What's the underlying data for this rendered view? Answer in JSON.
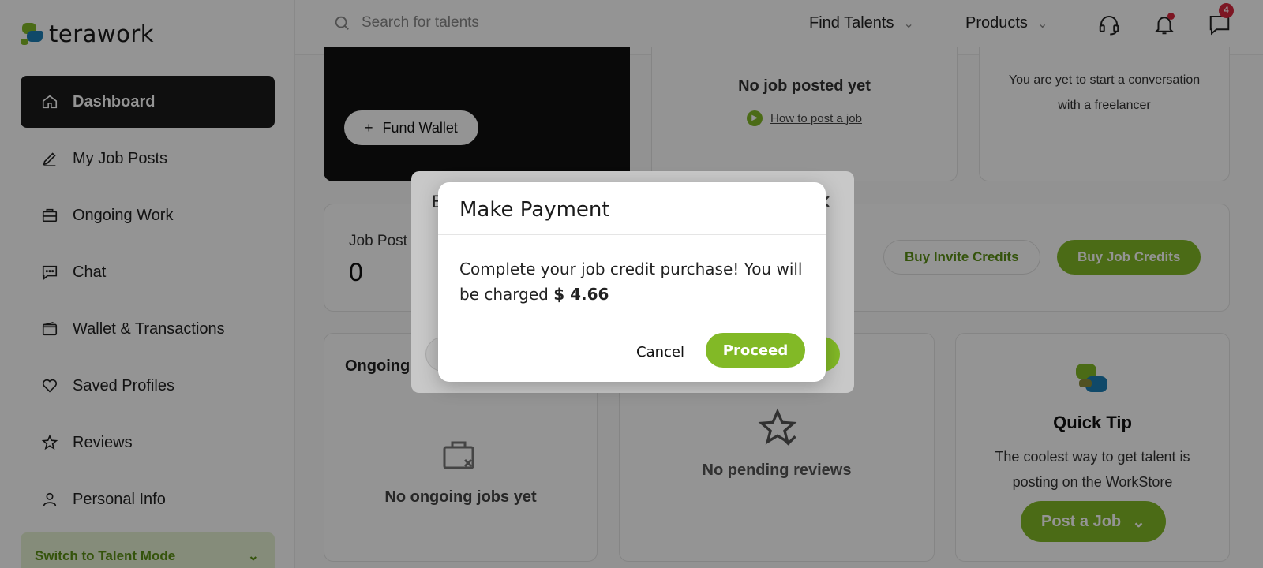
{
  "brand": {
    "name": "terawork"
  },
  "sidebar": {
    "items": [
      {
        "label": "Dashboard",
        "icon": "home-icon",
        "active": true
      },
      {
        "label": "My Job Posts",
        "icon": "pencil-icon"
      },
      {
        "label": "Ongoing Work",
        "icon": "briefcase-icon"
      },
      {
        "label": "Chat",
        "icon": "chat-icon"
      },
      {
        "label": "Wallet & Transactions",
        "icon": "wallet-icon"
      },
      {
        "label": "Saved Profiles",
        "icon": "heart-icon"
      },
      {
        "label": "Reviews",
        "icon": "star-icon"
      },
      {
        "label": "Personal Info",
        "icon": "user-icon"
      }
    ],
    "switch_mode": "Switch to Talent Mode"
  },
  "header": {
    "search_placeholder": "Search for talents",
    "menu": [
      "Find Talents",
      "Products"
    ],
    "messages_badge": "4"
  },
  "wallet": {
    "fund_label": "Fund Wallet"
  },
  "jobs_card": {
    "empty": "No job posted yet",
    "link": "How to post a job"
  },
  "conversation_card": {
    "empty": "You are yet to start a conversation with a freelancer"
  },
  "credits": {
    "job_posts_label": "Job Post",
    "job_posts_value": "0",
    "buy_invite": "Buy Invite Credits",
    "buy_job": "Buy Job Credits"
  },
  "ongoing": {
    "title": "Ongoing",
    "empty": "No ongoing jobs yet"
  },
  "reviews": {
    "empty": "No pending reviews"
  },
  "tip": {
    "title": "Quick Tip",
    "text": "The coolest way to get talent is posting on the WorkStore",
    "button": "Post a Job"
  },
  "back_modal": {
    "title_initial": "B"
  },
  "modal": {
    "title": "Make Payment",
    "message": "Complete your job credit purchase! You will be charged",
    "amount": "$ 4.66",
    "cancel": "Cancel",
    "proceed": "Proceed"
  },
  "colors": {
    "accent": "#82b926",
    "accent_dark": "#5a8f14",
    "dark": "#1b1b1b",
    "badge": "#d7263d"
  }
}
